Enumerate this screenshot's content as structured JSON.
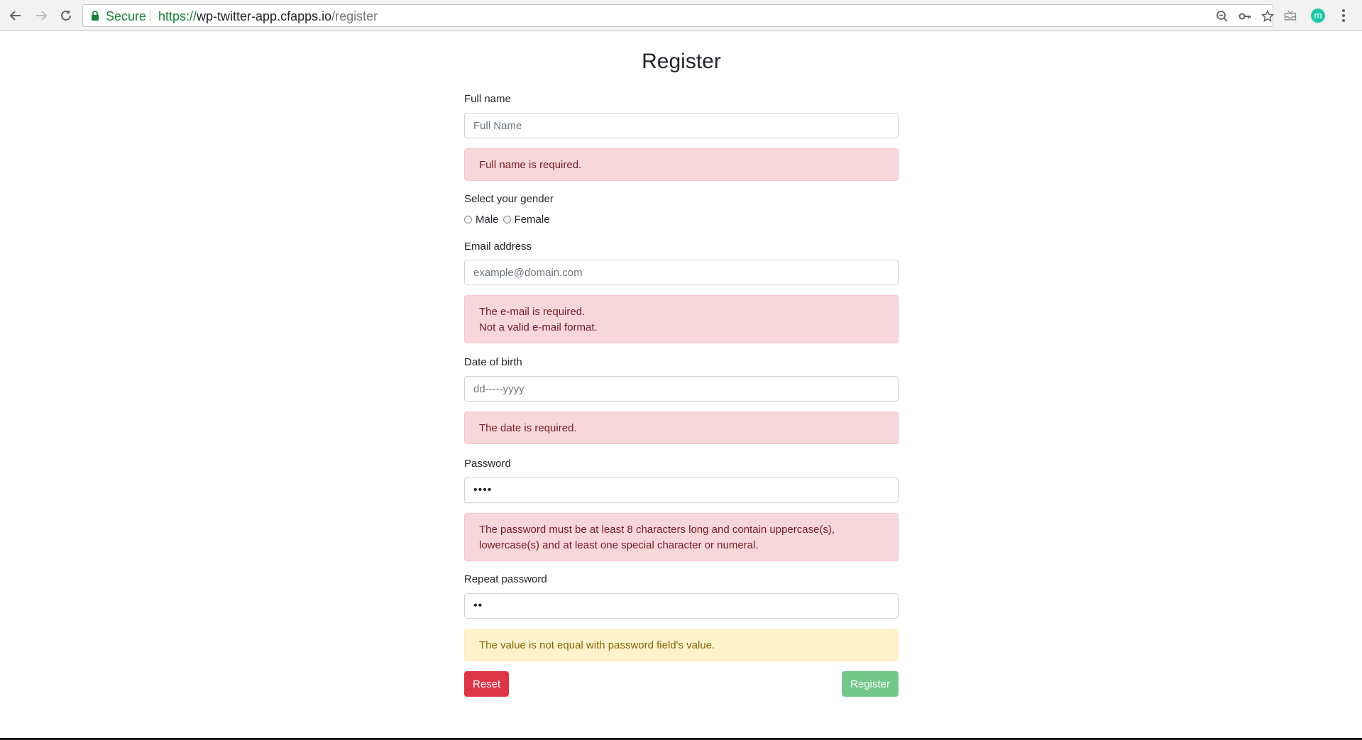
{
  "browser": {
    "secure_label": "Secure",
    "url_scheme": "https://",
    "url_host": "wp-twitter-app.cfapps.io",
    "url_path": "/register",
    "avatar_letter": "m",
    "avatar_color": "#1ec8a5"
  },
  "page": {
    "title": "Register",
    "full_name": {
      "label": "Full name",
      "placeholder": "Full Name",
      "error": "Full name is required."
    },
    "gender": {
      "label": "Select your gender",
      "options": [
        "Male",
        "Female"
      ]
    },
    "email": {
      "label": "Email address",
      "placeholder": "example@domain.com",
      "errors": [
        "The e-mail is required.",
        "Not a valid e-mail format."
      ]
    },
    "dob": {
      "label": "Date of birth",
      "placeholder": "dd-----yyyy",
      "error": "The date is required."
    },
    "password": {
      "label": "Password",
      "value": "••••",
      "error_lines": [
        "The password must be at least 8 characters long and contain uppercase(s),",
        "lowercase(s) and at least one special character or numeral."
      ]
    },
    "repeat_password": {
      "label": "Repeat password",
      "value": "••",
      "warning": "The value is not equal with password field's value."
    },
    "buttons": {
      "reset": "Reset",
      "register": "Register"
    }
  },
  "colors": {
    "danger": "#dc3545",
    "success": "#73c88a",
    "alert_danger_bg": "#f8d7da",
    "alert_warning_bg": "#fff3cd",
    "secure_green": "#188038"
  }
}
